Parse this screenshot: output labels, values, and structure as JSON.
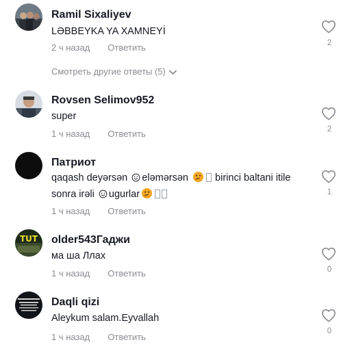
{
  "comments": [
    {
      "author": "Ramil Sixaliyev",
      "text": "LƏBBEYKA YA XAMNEYİ",
      "time": "2 ч назад",
      "reply": "Ответить",
      "likes": "2",
      "avatar": "group-photo-avatar"
    },
    {
      "author": "Rovsen Selimov952",
      "text": "super",
      "time": "1 ч назад",
      "reply": "Ответить",
      "likes": "2",
      "avatar": "man-photo-avatar"
    },
    {
      "author": "Патриот",
      "text_parts": [
        "qaqash deyərsən",
        "eləmərsən",
        "birinci baltani itile",
        "sonra irəli",
        "ugurlar"
      ],
      "time": "1 ч назад",
      "reply": "Ответить",
      "likes": "1",
      "avatar": "black-avatar"
    },
    {
      "author": "older543Гаджи",
      "text": "ма ша Ллах",
      "time": "1 ч назад",
      "reply": "Ответить",
      "likes": "0",
      "avatar": "yellow-text-avatar"
    },
    {
      "author": "Daqli qizi",
      "text": "Aleykum salam.Eyvallah",
      "time": "1 ч назад",
      "reply": "Ответить",
      "likes": "0",
      "avatar": "text-badge-avatar"
    }
  ],
  "more_replies_label": "Смотреть другие ответы (5)",
  "colors": {
    "muted": "#8a8b91",
    "text": "#161823",
    "emoji": "#f5a623"
  },
  "icons": {
    "like": "heart-outline-icon",
    "expand": "chevron-down-icon",
    "smile": "smiley-face-icon",
    "thinking": "thinking-face-emoji"
  }
}
